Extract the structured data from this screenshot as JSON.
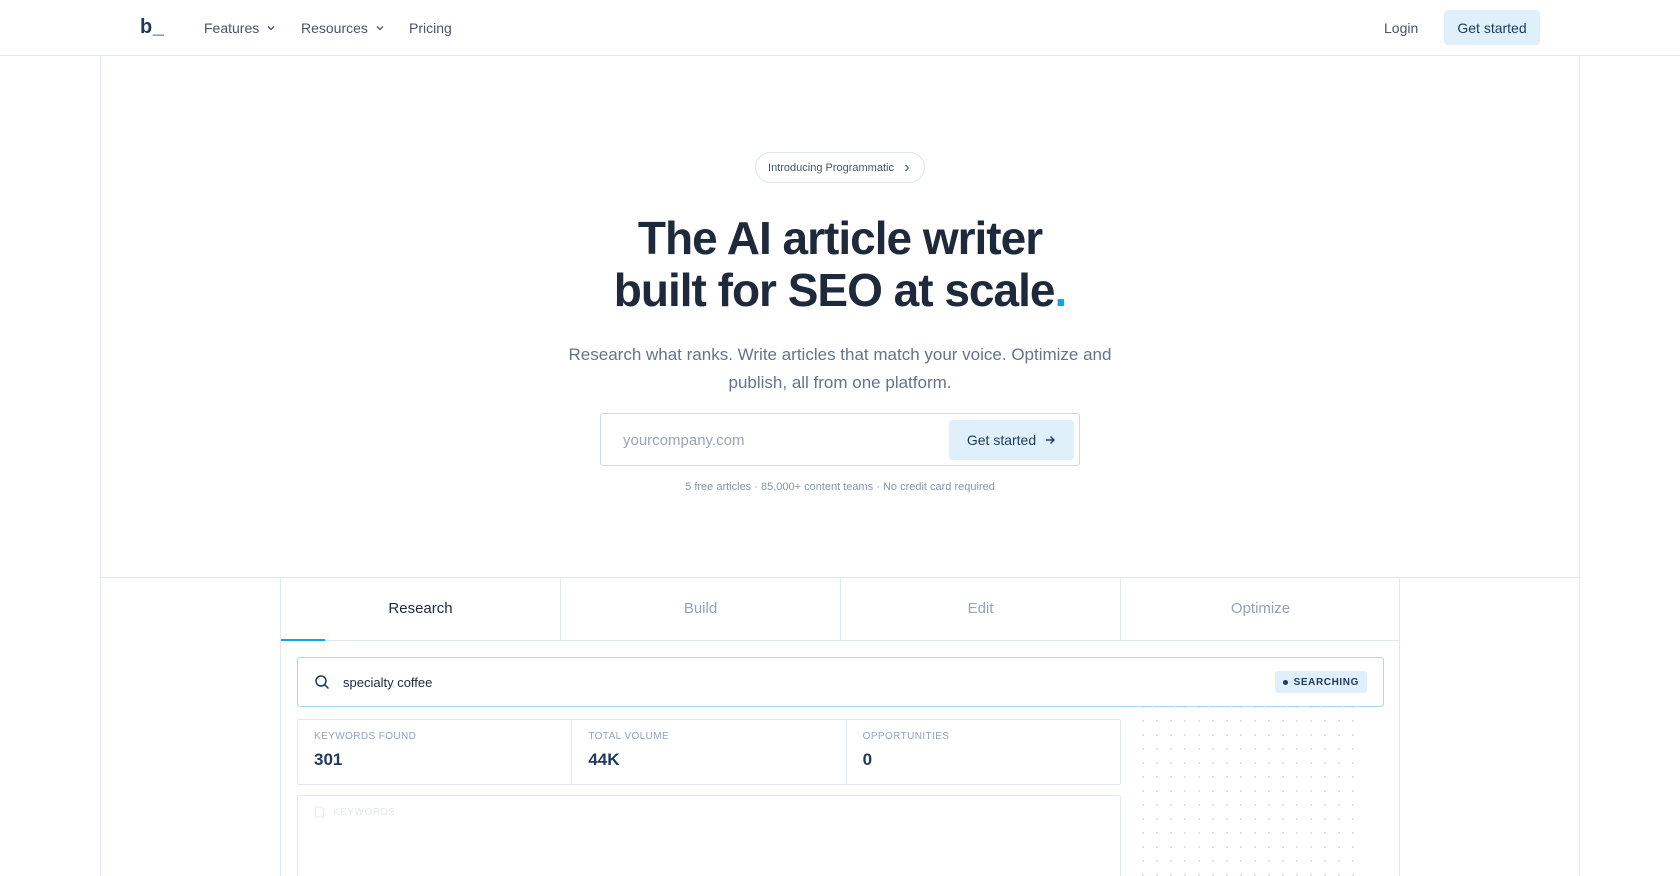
{
  "nav": {
    "logo": "b_",
    "features": "Features",
    "resources": "Resources",
    "pricing": "Pricing",
    "login": "Login",
    "get_started": "Get started"
  },
  "hero": {
    "pill": "Introducing Programmatic",
    "headline_line1": "The AI article writer",
    "headline_line2": "built for SEO at scale",
    "headline_dot": ".",
    "subtitle_line1": "Research what ranks. Write articles that match your voice. Optimize and",
    "subtitle_line2": "publish, all from one platform.",
    "input_placeholder": "yourcompany.com",
    "cta": "Get started",
    "fine_print": "5 free articles · 85,000+ content teams · No credit card required"
  },
  "demo": {
    "tabs": [
      "Research",
      "Build",
      "Edit",
      "Optimize"
    ],
    "active_tab": "Research",
    "search_query": "specialty coffee",
    "status": "SEARCHING",
    "stats": [
      {
        "label": "KEYWORDS FOUND",
        "value": "301"
      },
      {
        "label": "TOTAL VOLUME",
        "value": "44K"
      },
      {
        "label": "OPPORTUNITIES",
        "value": "0"
      }
    ],
    "keywords_header": "KEYWORDS"
  },
  "colors": {
    "accent": "#0ea5e9",
    "brand": "#1e3a5f",
    "button_bg": "#e0f0fb"
  }
}
